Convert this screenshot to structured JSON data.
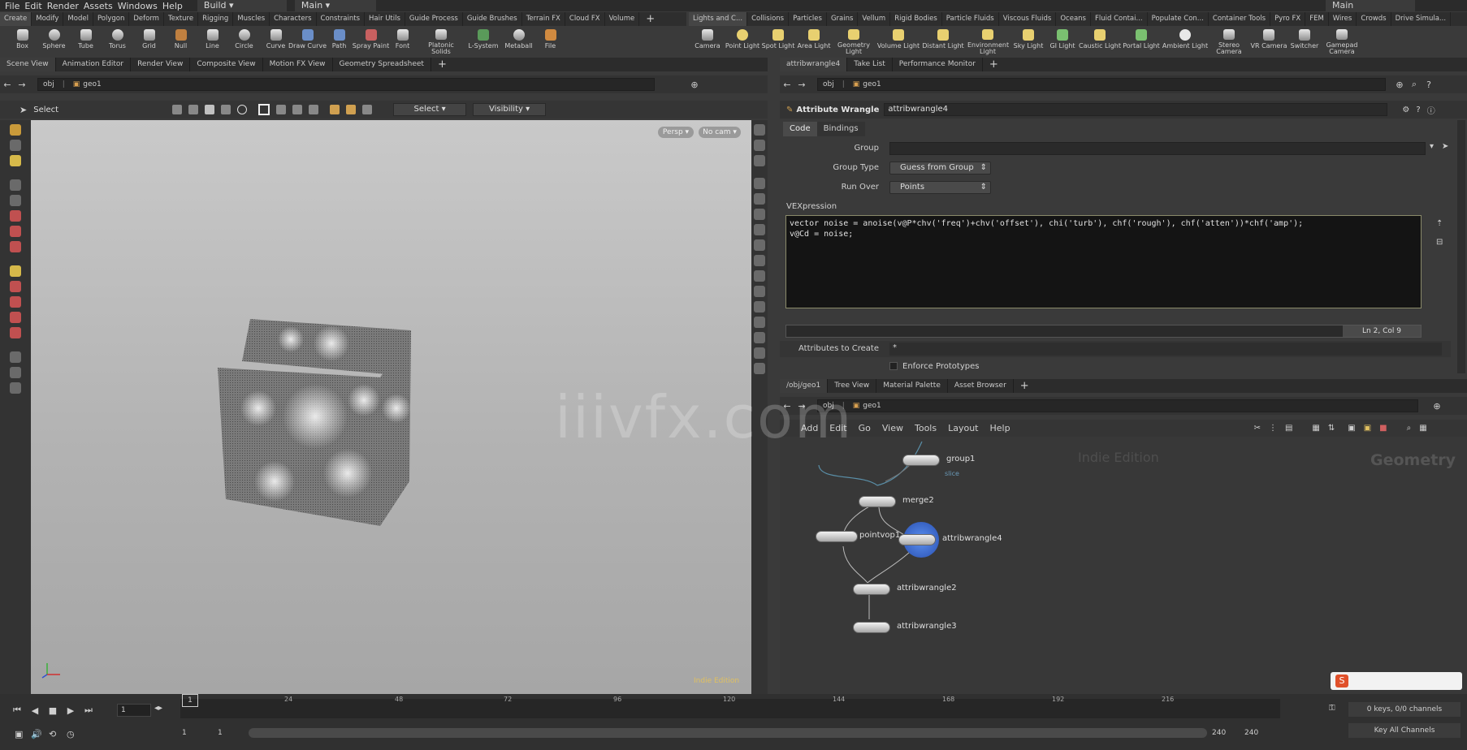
{
  "menubar": {
    "items": [
      "File",
      "Edit",
      "Render",
      "Assets",
      "Windows",
      "Help"
    ],
    "desktop": "Build",
    "desktop2": "Main",
    "desktop_right": "Main"
  },
  "shelf_left": {
    "tabs": [
      "Create",
      "Modify",
      "Model",
      "Polygon",
      "Deform",
      "Texture",
      "Rigging",
      "Muscles",
      "Characters",
      "Constraints",
      "Hair Utils",
      "Guide Process",
      "Guide Brushes",
      "Terrain FX",
      "Cloud FX",
      "Volume"
    ],
    "tools": [
      "Box",
      "Sphere",
      "Tube",
      "Torus",
      "Grid",
      "Null",
      "Line",
      "Circle",
      "Curve",
      "Draw Curve",
      "Path",
      "Spray Paint",
      "Font",
      "Platonic Solids",
      "L-System",
      "Metaball",
      "File"
    ]
  },
  "shelf_right": {
    "tabs": [
      "Lights and C...",
      "Collisions",
      "Particles",
      "Grains",
      "Vellum",
      "Rigid Bodies",
      "Particle Fluids",
      "Viscous Fluids",
      "Oceans",
      "Fluid Contai...",
      "Populate Con...",
      "Container Tools",
      "Pyro FX",
      "FEM",
      "Wires",
      "Crowds",
      "Drive Simula..."
    ],
    "tools": [
      "Camera",
      "Point Light",
      "Spot Light",
      "Area Light",
      "Geometry Light",
      "Volume Light",
      "Distant Light",
      "Environment Light",
      "Sky Light",
      "GI Light",
      "Caustic Light",
      "Portal Light",
      "Ambient Light",
      "Stereo Camera",
      "VR Camera",
      "Switcher",
      "Gamepad Camera"
    ]
  },
  "left_pane": {
    "tabs": [
      "Scene View",
      "Animation Editor",
      "Render View",
      "Composite View",
      "Motion FX View",
      "Geometry Spreadsheet"
    ],
    "path": [
      "obj",
      "geo1"
    ],
    "toolbar": {
      "select_label": "Select",
      "select_mode": "Select",
      "visibility": "Visibility"
    },
    "view_persp": "Persp",
    "view_cam": "No cam",
    "edition": "Indie Edition"
  },
  "param_pane": {
    "tabs": [
      "attribwrangle4",
      "Take List",
      "Performance Monitor"
    ],
    "path": [
      "obj",
      "geo1"
    ],
    "node_type": "Attribute Wrangle",
    "node_name": "attribwrangle4",
    "subtabs": [
      "Code",
      "Bindings"
    ],
    "group_label": "Group",
    "group_value": "",
    "group_type_label": "Group Type",
    "group_type_value": "Guess from Group",
    "run_over_label": "Run Over",
    "run_over_value": "Points",
    "vex_label": "VEXpression",
    "code_line1": "vector noise = anoise(v@P*chv('freq')+chv('offset'), chi('turb'), chf('rough'), chf('atten'))*chf('amp');",
    "code_line2": "v@Cd = noise;",
    "cursor_pos": "Ln 2, Col 9",
    "attrs_label": "Attributes to Create",
    "attrs_value": "*",
    "enforce_label": "Enforce Prototypes"
  },
  "network_pane": {
    "tabs": [
      "/obj/geo1",
      "Tree View",
      "Material Palette",
      "Asset Browser"
    ],
    "path": [
      "obj",
      "geo1"
    ],
    "menu": [
      "Add",
      "Edit",
      "Go",
      "View",
      "Tools",
      "Layout",
      "Help"
    ],
    "edition": "Indie Edition",
    "context": "Geometry",
    "nodes": [
      "group1",
      "merge2",
      "pointvop1",
      "attribwrangle4",
      "attribwrangle2",
      "attribwrangle3"
    ],
    "wire_label": "slice"
  },
  "timeline": {
    "ticks": [
      "24",
      "48",
      "72",
      "96",
      "120",
      "144",
      "168",
      "192",
      "216"
    ],
    "frame": "1",
    "current_marker": "1",
    "range_start": "1",
    "range_start2": "1",
    "range_end": "240",
    "range_end2": "240",
    "keys_info": "0 keys, 0/0 channels",
    "key_all": "Key All Channels"
  },
  "watermark": "iiivfx.com",
  "colors": {
    "accent": "#e0c060",
    "selected_node": "#3a6fd8"
  }
}
